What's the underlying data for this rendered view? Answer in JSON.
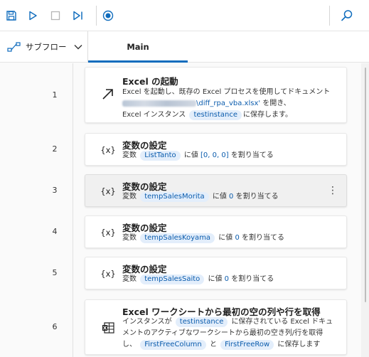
{
  "toolbar": {
    "icons": [
      "save-icon",
      "run-icon",
      "stop-icon",
      "step-icon",
      "record-icon",
      "search-icon"
    ],
    "accent": "#0f6cbd"
  },
  "tabs": {
    "subflow_label": "サブフロー",
    "main_label": "Main"
  },
  "actions": [
    {
      "row": "1",
      "icon": "arrow-up-right-icon",
      "title": "Excel の起動",
      "desc1": "Excel を起動し、既存の Excel プロセスを使用してドキュメント",
      "path_tail": "\\diff_rpa_vba.xlsx'",
      "desc2b": " を開き、",
      "desc3a": "Excel インスタンス",
      "var": "testinstance",
      "desc3b": "に保存します。"
    },
    {
      "row": "2",
      "icon": "{x}",
      "title": "変数の設定",
      "prefix": "変数",
      "var": "ListTanto",
      "mid": "に値",
      "value": "[0, 0, 0]",
      "suffix": "を割り当てる"
    },
    {
      "row": "3",
      "icon": "{x}",
      "title": "変数の設定",
      "prefix": "変数",
      "var": "tempSalesMorita",
      "mid": "に値",
      "value": "0",
      "suffix": "を割り当てる"
    },
    {
      "row": "4",
      "icon": "{x}",
      "title": "変数の設定",
      "prefix": "変数",
      "var": "tempSalesKoyama",
      "mid": "に値",
      "value": "0",
      "suffix": "を割り当てる"
    },
    {
      "row": "5",
      "icon": "{x}",
      "title": "変数の設定",
      "prefix": "変数",
      "var": "tempSalesSaito",
      "mid": "に値",
      "value": "0",
      "suffix": "を割り当てる"
    },
    {
      "row": "6",
      "icon": "excel-table-icon",
      "title": "Excel ワークシートから最初の空の列や行を取得",
      "desc1a": "インスタンスが",
      "var1": "testinstance",
      "desc1b": "に保存されている Excel ドキュ",
      "desc2": "メントのアクティブなワークシートから最初の空き列/行を取得",
      "desc3a": "し、",
      "var2": "FirstFreeColumn",
      "desc3b": "と",
      "var3": "FirstFreeRow",
      "desc3c": "に保存します"
    }
  ]
}
